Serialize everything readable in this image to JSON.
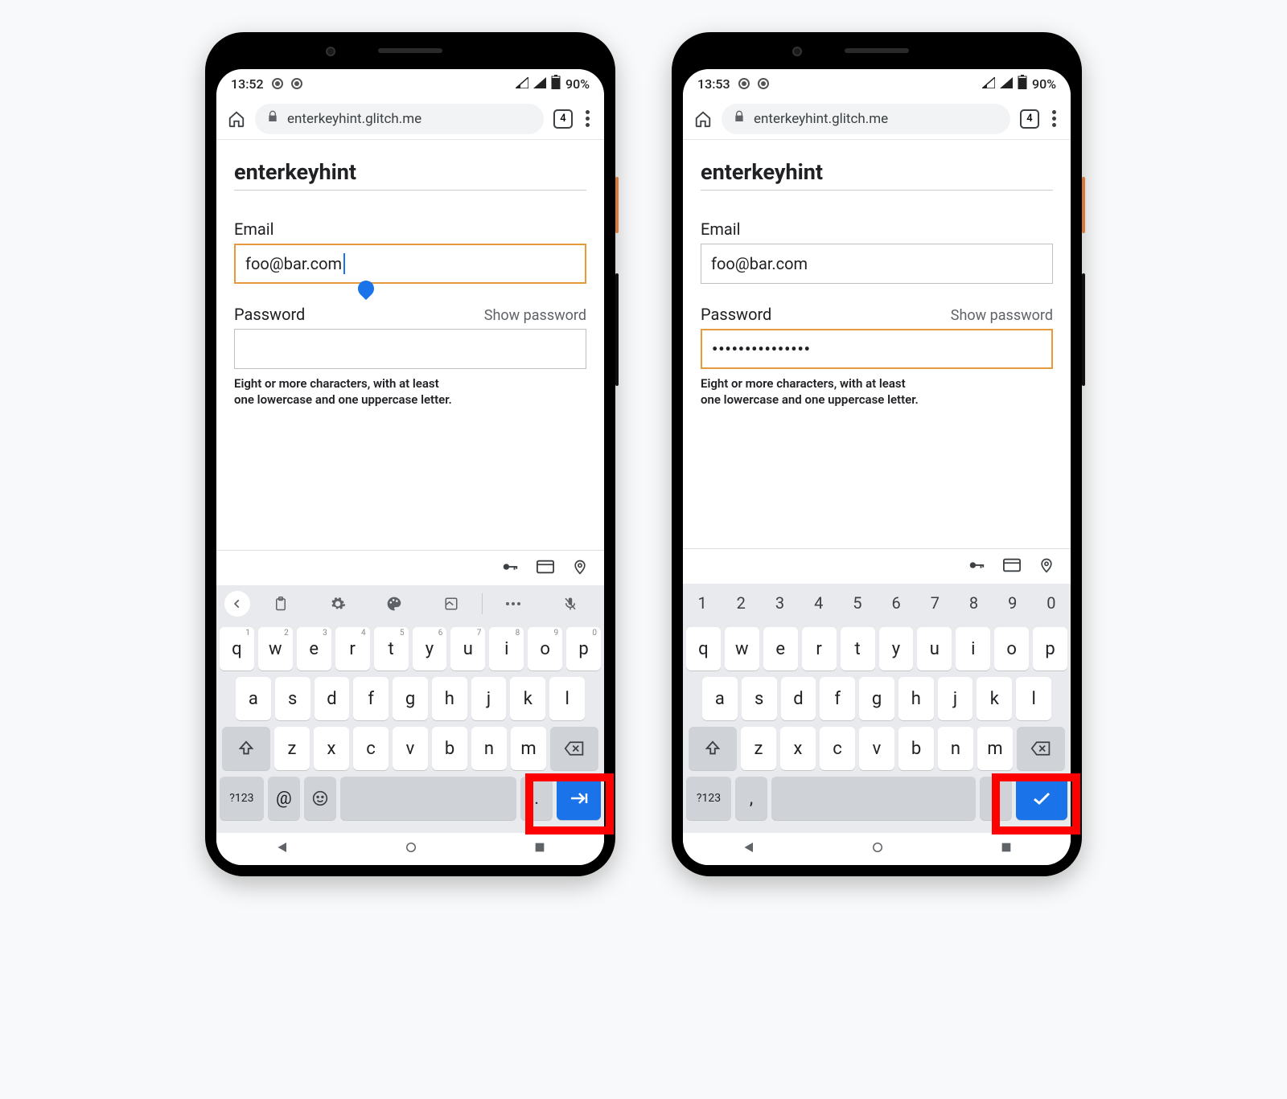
{
  "phones": [
    {
      "status": {
        "time": "13:52",
        "battery": "90%"
      },
      "browser": {
        "url": "enterkeyhint.glitch.me",
        "tab_count": "4"
      },
      "page": {
        "title": "enterkeyhint",
        "email_label": "Email",
        "email_value": "foo@bar.com",
        "email_focused": true,
        "password_label": "Password",
        "show_password": "Show password",
        "password_value": "",
        "password_focused": false,
        "hint_line1": "Eight or more characters, with at least",
        "hint_line2": "one lowercase and one uppercase letter."
      },
      "keyboard": {
        "show_toolbar": true,
        "show_numrow": false,
        "row1": [
          "q",
          "w",
          "e",
          "r",
          "t",
          "y",
          "u",
          "i",
          "o",
          "p"
        ],
        "row1_super": [
          "1",
          "2",
          "3",
          "4",
          "5",
          "6",
          "7",
          "8",
          "9",
          "0"
        ],
        "row2": [
          "a",
          "s",
          "d",
          "f",
          "g",
          "h",
          "j",
          "k",
          "l"
        ],
        "row3": [
          "z",
          "x",
          "c",
          "v",
          "b",
          "n",
          "m"
        ],
        "bottom": {
          "mode": "?123",
          "extra1": "@",
          "extra2_is_emoji": true,
          "period": ".",
          "enter_icon": "next"
        }
      }
    },
    {
      "status": {
        "time": "13:53",
        "battery": "90%"
      },
      "browser": {
        "url": "enterkeyhint.glitch.me",
        "tab_count": "4"
      },
      "page": {
        "title": "enterkeyhint",
        "email_label": "Email",
        "email_value": "foo@bar.com",
        "email_focused": false,
        "password_label": "Password",
        "show_password": "Show password",
        "password_value": "•••••••••••••••",
        "password_focused": true,
        "hint_line1": "Eight or more characters, with at least",
        "hint_line2": "one lowercase and one uppercase letter."
      },
      "keyboard": {
        "show_toolbar": false,
        "show_numrow": true,
        "numrow": [
          "1",
          "2",
          "3",
          "4",
          "5",
          "6",
          "7",
          "8",
          "9",
          "0"
        ],
        "row1": [
          "q",
          "w",
          "e",
          "r",
          "t",
          "y",
          "u",
          "i",
          "o",
          "p"
        ],
        "row1_super": [],
        "row2": [
          "a",
          "s",
          "d",
          "f",
          "g",
          "h",
          "j",
          "k",
          "l"
        ],
        "row3": [
          "z",
          "x",
          "c",
          "v",
          "b",
          "n",
          "m"
        ],
        "bottom": {
          "mode": "?123",
          "extra1": ",",
          "extra2_is_emoji": false,
          "period": ".",
          "enter_icon": "done"
        }
      }
    }
  ]
}
